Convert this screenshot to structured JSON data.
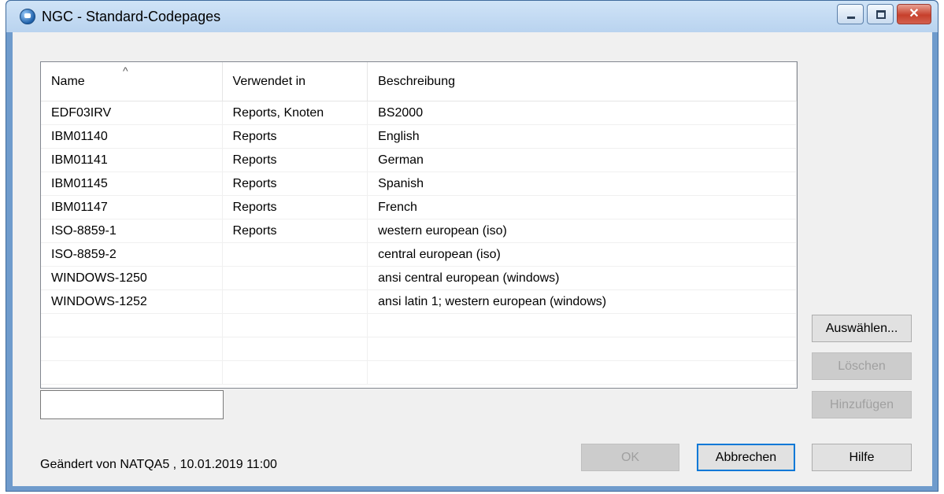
{
  "window": {
    "title": "NGC - Standard-Codepages",
    "close_glyph": "✕"
  },
  "listview": {
    "columns": [
      "Name",
      "Verwendet in",
      "Beschreibung"
    ],
    "rows": [
      [
        "EDF03IRV",
        "Reports, Knoten",
        "BS2000"
      ],
      [
        "IBM01140",
        "Reports",
        "English"
      ],
      [
        "IBM01141",
        "Reports",
        "German"
      ],
      [
        "IBM01145",
        "Reports",
        "Spanish"
      ],
      [
        "IBM01147",
        "Reports",
        "French"
      ],
      [
        "ISO-8859-1",
        "Reports",
        "western european (iso)"
      ],
      [
        "ISO-8859-2",
        "",
        "central european (iso)"
      ],
      [
        "WINDOWS-1250",
        "",
        "ansi central european (windows)"
      ],
      [
        "WINDOWS-1252",
        "",
        "ansi latin 1; western european (windows)"
      ],
      [
        "",
        "",
        ""
      ],
      [
        "",
        "",
        ""
      ],
      [
        "",
        "",
        ""
      ]
    ],
    "sort_glyph": "^"
  },
  "edit": {
    "value": ""
  },
  "buttons": {
    "select": "Auswählen...",
    "delete": "Löschen",
    "add": "Hinzufügen",
    "ok": "OK",
    "cancel": "Abbrechen",
    "help": "Hilfe"
  },
  "status": {
    "text": "Geändert von NATQA5 , 10.01.2019 11:00"
  },
  "colors": {
    "titlebar": "#b9d3ef",
    "dialog_bg": "#f0f0f0",
    "default_button_border": "#0078d7",
    "close_button": "#c7402c"
  }
}
